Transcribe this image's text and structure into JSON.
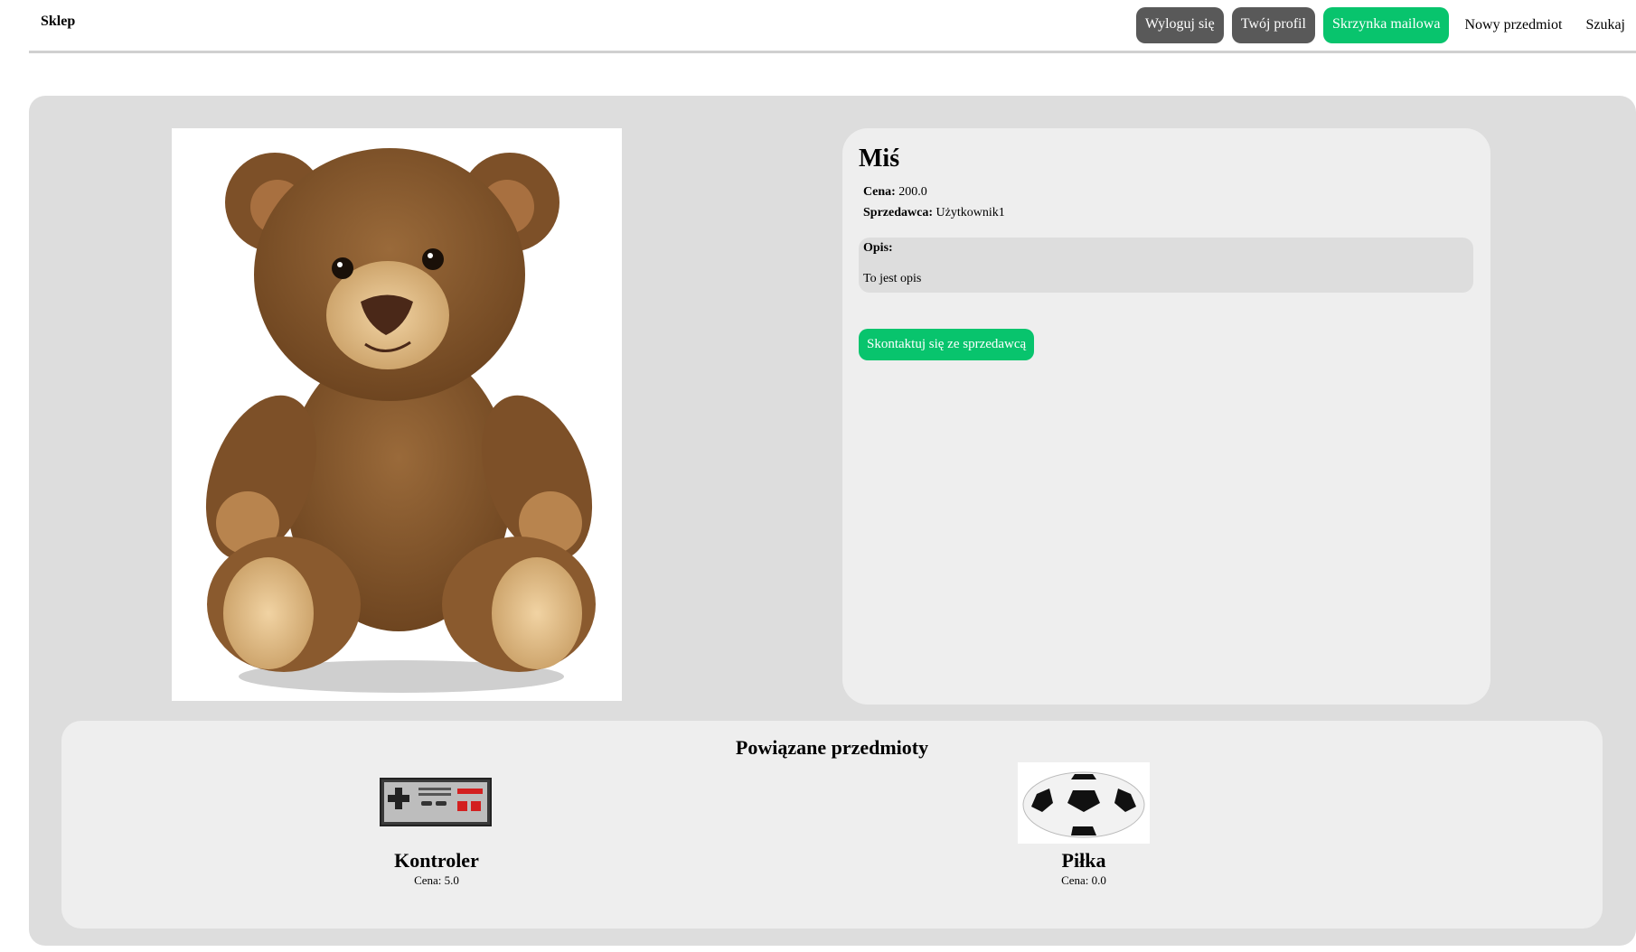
{
  "nav": {
    "brand": "Sklep",
    "logout": "Wyloguj się",
    "profile": "Twój profil",
    "mailbox": "Skrzynka mailowa",
    "new_item": "Nowy przedmiot",
    "search": "Szukaj"
  },
  "product": {
    "name": "Miś",
    "price_label": "Cena:",
    "price": "200.0",
    "seller_label": "Sprzedawca:",
    "seller": "Użytkownik1",
    "description_label": "Opis:",
    "description": "To jest opis",
    "contact_button": "Skontaktuj się ze sprzedawcą",
    "image": "teddy-bear-photo"
  },
  "related": {
    "title": "Powiązane przedmioty",
    "items": [
      {
        "name": "Kontroler",
        "price": "Cena: 5.0",
        "image": "gamepad-image"
      },
      {
        "name": "Piłka",
        "price": "Cena: 0.0",
        "image": "soccer-ball-image"
      }
    ]
  },
  "colors": {
    "accent_green": "#08c46d",
    "dark_button": "#595959",
    "panel_bg": "#dddddd",
    "card_bg": "#eeeeee"
  }
}
